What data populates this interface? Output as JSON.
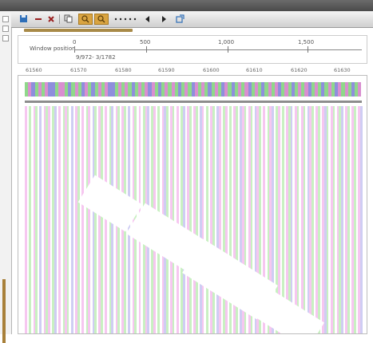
{
  "window": {
    "title": ""
  },
  "toolbar": {
    "buttons": [
      {
        "icon": "save-icon",
        "color": "#2f6fb8"
      },
      {
        "icon": "minus-icon",
        "color": "#9a2020"
      },
      {
        "icon": "close-icon",
        "color": "#9a2020"
      },
      {
        "icon": "copy-icon",
        "color": "#555555"
      },
      {
        "icon": "zoom-in-icon",
        "color": "#a97a20"
      },
      {
        "icon": "zoom-out-icon",
        "color": "#a97a20"
      },
      {
        "icon": "first-icon",
        "color": "#222222"
      },
      {
        "icon": "prev-icon",
        "color": "#222222"
      },
      {
        "icon": "next-icon",
        "color": "#222222"
      },
      {
        "icon": "last-icon",
        "color": "#222222"
      },
      {
        "icon": "dock-icon",
        "color": "#2f6fb8"
      }
    ]
  },
  "ruler": {
    "window_position_label": "Window position",
    "tick_labels": [
      "0",
      "500",
      "1,000",
      "1,500"
    ],
    "range_text": "9/972- 3/1782"
  },
  "positions": [
    "61560",
    "61570",
    "61580",
    "61590",
    "61600",
    "61610",
    "61620",
    "61630"
  ],
  "colors": {
    "pink": "#f6c7f0",
    "green": "#c9f0c2",
    "lavender": "#cfcdf3",
    "white": "#ffffff",
    "consensus_pink": "#d98fd0",
    "consensus_green": "#8fd88a",
    "consensus_blue": "#8e8fdc"
  },
  "consensus_pattern": "gpbgpgpbbgppgbgpgbpgbgpgpbbgpgpgbgpgpbpgbgpgpgbgpgbpgpgbgpgbpgbgpgpbgpgbgpgpbgpgbgpgpbgpgbgpgbpgpgbgp",
  "alignment_pattern": "pwgwpgwbwpgpwgbwpwgpgwbwpgwpwgpwbgwpgwpwgbwpgwpgwbwpgwpwgpbwgpwgwpbgwpgwpwgbwpgwpgwbpwgwpgwbpwgpwgwpgwbpgwpgwbpgwpwgpbwgpwgwpgbwpgwpgwbpgwpgwpbgwpgwpgbwpgwpgwpb"
}
